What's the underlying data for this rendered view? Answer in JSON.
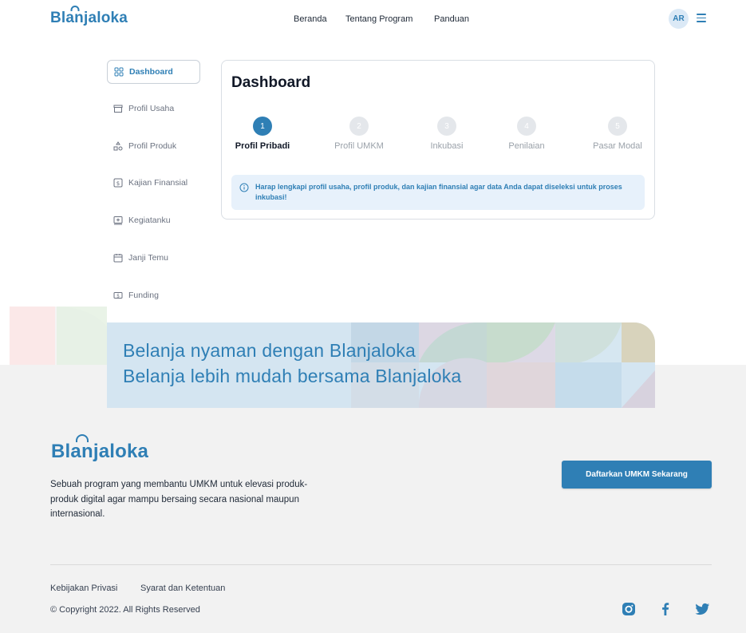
{
  "header": {
    "logo_prefix": "Bl",
    "logo_bag": "an",
    "logo_suffix": "jaloka",
    "nav": [
      "Beranda",
      "Tentang Program",
      "Panduan"
    ],
    "avatar_initials": "AR"
  },
  "sidebar": {
    "items": [
      {
        "label": "Dashboard",
        "icon": "grid-icon"
      },
      {
        "label": "Profil Usaha",
        "icon": "store-icon"
      },
      {
        "label": "Profil Produk",
        "icon": "shapes-icon"
      },
      {
        "label": "Kajian Finansial",
        "icon": "dollar-icon"
      },
      {
        "label": "Kegiatanku",
        "icon": "plus-box-icon"
      },
      {
        "label": "Janji Temu",
        "icon": "calendar-icon"
      },
      {
        "label": "Funding",
        "icon": "money-icon"
      }
    ]
  },
  "dashboard": {
    "title": "Dashboard",
    "steps": [
      {
        "number": "1",
        "label": "Profil Pribadi"
      },
      {
        "number": "2",
        "label": "Profil UMKM"
      },
      {
        "number": "3",
        "label": "Inkubasi"
      },
      {
        "number": "4",
        "label": "Penilaian"
      },
      {
        "number": "5",
        "label": "Pasar Modal"
      }
    ],
    "alert": "Harap lengkapi profil usaha, profil produk, dan kajian finansial agar data Anda dapat diseleksi untuk proses inkubasi!"
  },
  "banner": {
    "line1": "Belanja nyaman dengan Blanjaloka",
    "line2": "Belanja lebih mudah bersama Blanjaloka"
  },
  "footer": {
    "description": "Sebuah program yang membantu UMKM untuk elevasi produk-produk digital agar mampu bersaing secara nasional maupun internasional.",
    "cta": "Daftarkan UMKM Sekarang",
    "links": [
      "Kebijakan Privasi",
      "Syarat dan Ketentuan"
    ],
    "copyright": "© Copyright 2022. All Rights Reserved"
  },
  "colors": {
    "brand": "#2f7fb5",
    "alert_bg": "#e7f1fb",
    "footer_bg": "#f2f2f2",
    "banner_bg": "#d4e5f1"
  }
}
